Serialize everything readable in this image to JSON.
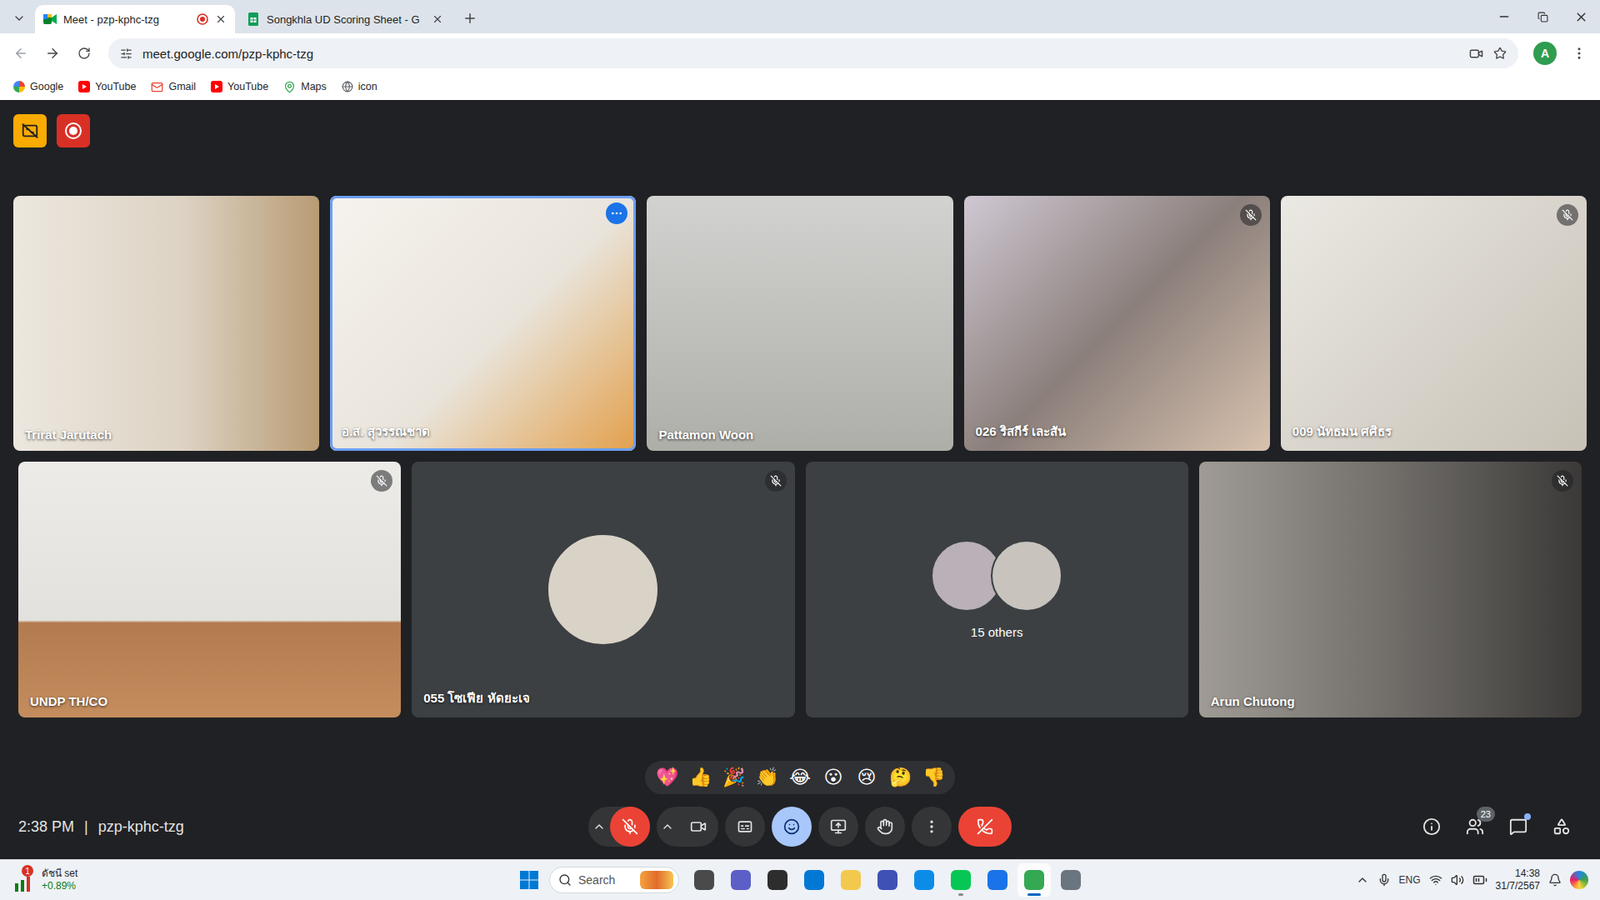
{
  "browser": {
    "tabs": [
      {
        "title": "Meet - pzp-kphc-tzg",
        "selected": true,
        "recording": true,
        "kind": "meet"
      },
      {
        "title": "Songkhla UD Scoring Sheet - G",
        "selected": false,
        "recording": false,
        "kind": "sheets"
      }
    ],
    "url": "meet.google.com/pzp-kphc-tzg",
    "profile": "A",
    "bookmarks": [
      {
        "label": "Google",
        "kind": "google"
      },
      {
        "label": "YouTube",
        "kind": "youtube"
      },
      {
        "label": "Gmail",
        "kind": "gmail"
      },
      {
        "label": "YouTube",
        "kind": "youtube"
      },
      {
        "label": "Maps",
        "kind": "maps"
      },
      {
        "label": "icon",
        "kind": "globe"
      }
    ]
  },
  "meeting": {
    "indicators": {
      "captions_off": true,
      "recording": true
    },
    "rows": [
      [
        {
          "name": "Trirat Jarutach",
          "kind": "video",
          "muted": false,
          "speaking": false
        },
        {
          "name": "อ.ส. สุวรรณชาต",
          "kind": "video",
          "muted": false,
          "speaking": true
        },
        {
          "name": "Pattamon Woon",
          "kind": "video",
          "muted": false,
          "speaking": false
        },
        {
          "name": "026 ริสกีร์ เละสัน",
          "kind": "video",
          "muted": true,
          "speaking": false
        },
        {
          "name": "009 นัทธมน ศศิธร",
          "kind": "video",
          "muted": true,
          "speaking": false
        }
      ],
      [
        {
          "name": "UNDP TH/CO",
          "kind": "video",
          "muted": true,
          "speaking": false
        },
        {
          "name": "055 โซเฟีย หัดยะเจ",
          "kind": "avatar",
          "muted": true,
          "speaking": false
        },
        {
          "name": "15 others",
          "kind": "others",
          "muted": false,
          "speaking": false
        },
        {
          "name": "Arun Chutong",
          "kind": "video",
          "muted": true,
          "speaking": false
        }
      ]
    ],
    "reactions": [
      "💖",
      "👍",
      "🎉",
      "👏",
      "😂",
      "😮",
      "😢",
      "🤔",
      "👎"
    ],
    "bar": {
      "time": "2:38 PM",
      "separator": "|",
      "code": "pzp-kphc-tzg",
      "mic_muted": true,
      "camera_on": true,
      "reactions_open": true,
      "people_count": "23",
      "chat_unread": true
    }
  },
  "taskbar": {
    "widget": {
      "title": "ดัชนี set",
      "value": "+0.89%",
      "badge": "1"
    },
    "search": "Search",
    "apps": [
      {
        "running": false,
        "selected": false
      },
      {
        "running": false,
        "selected": false
      },
      {
        "running": false,
        "selected": false
      },
      {
        "running": false,
        "selected": false
      },
      {
        "running": false,
        "selected": false
      },
      {
        "running": false,
        "selected": false
      },
      {
        "running": false,
        "selected": false
      },
      {
        "running": true,
        "selected": false
      },
      {
        "running": false,
        "selected": false
      },
      {
        "running": true,
        "selected": true
      },
      {
        "running": false,
        "selected": false
      }
    ],
    "language": "ENG",
    "time": "14:38",
    "date": "31/7/2567"
  }
}
